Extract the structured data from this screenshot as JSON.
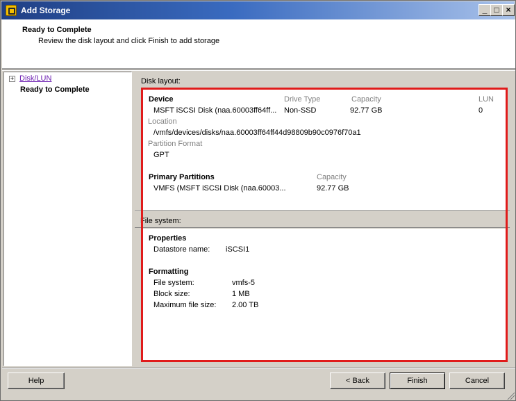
{
  "window": {
    "title": "Add Storage",
    "controls": {
      "minimize": "_",
      "maximize": "□",
      "close": "×"
    }
  },
  "header": {
    "title": "Ready to Complete",
    "subtitle": "Review the disk layout and click Finish to add storage"
  },
  "nav": {
    "expander": "+",
    "items": [
      {
        "label": "Disk/LUN"
      },
      {
        "label": "Ready to Complete"
      }
    ]
  },
  "disk_layout": {
    "section_label": "Disk layout:",
    "device": {
      "heading": "Device",
      "drive_type_header": "Drive Type",
      "capacity_header": "Capacity",
      "lun_header": "LUN",
      "name": "MSFT iSCSI Disk (naa.60003ff64ff...",
      "drive_type": "Non-SSD",
      "capacity": "92.77 GB",
      "lun": "0"
    },
    "location": {
      "label": "Location",
      "value": "/vmfs/devices/disks/naa.60003ff64ff44d98809b90c0976f70a1"
    },
    "partition_format": {
      "label": "Partition Format",
      "value": "GPT"
    },
    "primary_partitions": {
      "heading": "Primary Partitions",
      "capacity_header": "Capacity",
      "name": "VMFS (MSFT iSCSI Disk (naa.60003...",
      "capacity": "92.77 GB"
    }
  },
  "file_system": {
    "section_label": "File system:",
    "properties": {
      "heading": "Properties",
      "datastore_label": "Datastore name:",
      "datastore_value": "iSCSI1"
    },
    "formatting": {
      "heading": "Formatting",
      "fs_label": "File system:",
      "fs_value": "vmfs-5",
      "block_label": "Block size:",
      "block_value": "1 MB",
      "max_label": "Maximum file size:",
      "max_value": "2.00 TB"
    }
  },
  "buttons": {
    "help": "Help",
    "back": "< Back",
    "finish": "Finish",
    "cancel": "Cancel"
  },
  "colors": {
    "highlight_box": "#e01b1b",
    "link": "#6a1bb0"
  }
}
